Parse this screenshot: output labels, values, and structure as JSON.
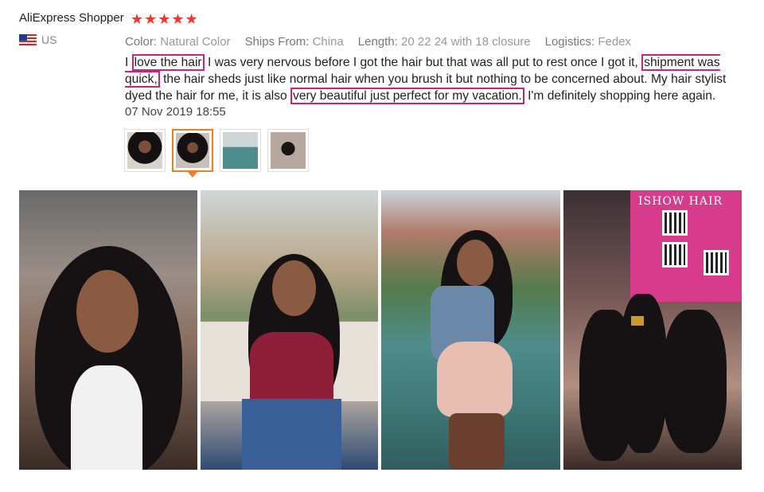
{
  "review": {
    "reviewer_name": "AliExpress Shopper",
    "stars": "★★★★★",
    "country": "US",
    "meta": [
      {
        "key": "Color:",
        "value": "Natural Color"
      },
      {
        "key": "Ships From:",
        "value": "China"
      },
      {
        "key": "Length:",
        "value": "20 22 24 with 18 closure"
      },
      {
        "key": "Logistics:",
        "value": "Fedex"
      }
    ],
    "text_parts": [
      {
        "text": "I ",
        "highlight": false
      },
      {
        "text": "love the hair",
        "highlight": true
      },
      {
        "text": " I was very nervous before I got the hair but that was all put to rest once I got it, ",
        "highlight": false
      },
      {
        "text": "shipment was quick,",
        "highlight": true
      },
      {
        "text": " the hair sheds just like normal hair when you brush it but nothing to be concerned about. My hair stylist dyed the hair for me, it is also ",
        "highlight": false
      },
      {
        "text": "very beautiful just perfect for my vacation.",
        "highlight": true
      },
      {
        "text": " I'm definitely shopping here again.",
        "highlight": false
      }
    ],
    "date": "07 Nov 2019 18:55",
    "thumbnails": [
      {
        "name": "photo-1",
        "active": false
      },
      {
        "name": "photo-2",
        "active": true
      },
      {
        "name": "photo-3",
        "active": false
      },
      {
        "name": "photo-4",
        "active": false
      }
    ],
    "photo_bag_text": "ISHOW HAIR",
    "colors": {
      "stars": "#f2362f",
      "highlight_box": "#c4277a",
      "active_thumb": "#f27d1f"
    }
  }
}
